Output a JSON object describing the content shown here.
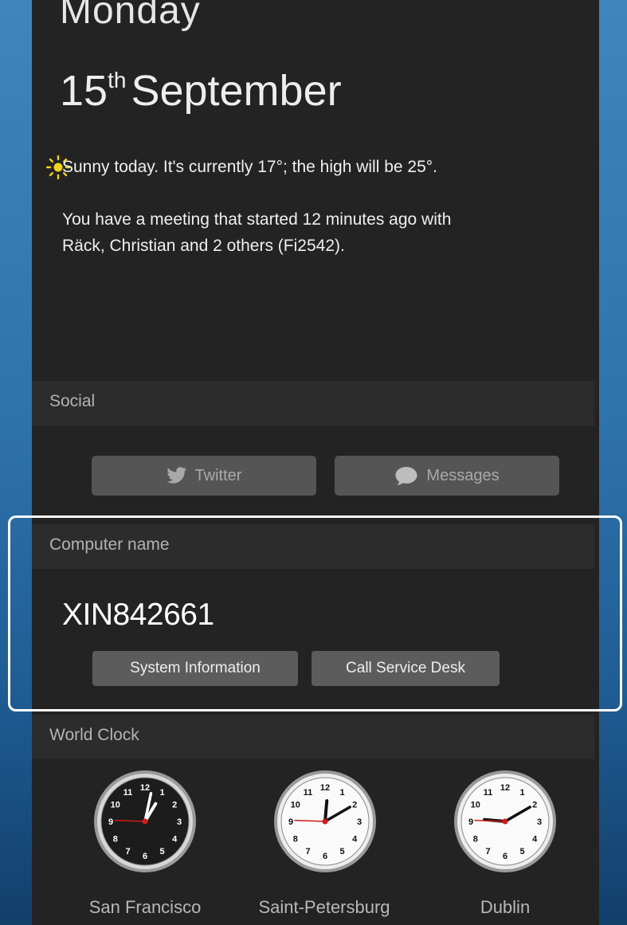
{
  "today": {
    "day": "Monday",
    "date_day": "15",
    "date_suffix": "th",
    "date_month": "September"
  },
  "summary": {
    "weather_icon": "sun-icon",
    "weather_text": "Sunny today. It's currently 17°; the high will be 25°.",
    "meeting_text": "You have a meeting that started 12 minutes ago with Räck, Christian and 2 others (Fi2542)."
  },
  "social": {
    "title": "Social",
    "twitter_label": "Twitter",
    "twitter_icon": "twitter-bird-icon",
    "messages_label": "Messages",
    "messages_icon": "speech-bubble-icon"
  },
  "computer": {
    "title": "Computer name",
    "name": "XIN842661",
    "system_info_label": "System Information",
    "call_desk_label": "Call Service Desk"
  },
  "world_clock": {
    "title": "World Clock",
    "clocks": [
      {
        "city": "San Francisco",
        "theme": "dark",
        "time": "1:02"
      },
      {
        "city": "Saint-Petersburg",
        "theme": "light",
        "time": "12:10"
      },
      {
        "city": "Dublin",
        "theme": "light",
        "time": "9:10"
      }
    ]
  },
  "colors": {
    "panel": "#232323",
    "section_header": "#2c2c2c",
    "highlight": "#ffffff",
    "sun": "#f2d21b",
    "second_hand": "#d21a1a"
  }
}
